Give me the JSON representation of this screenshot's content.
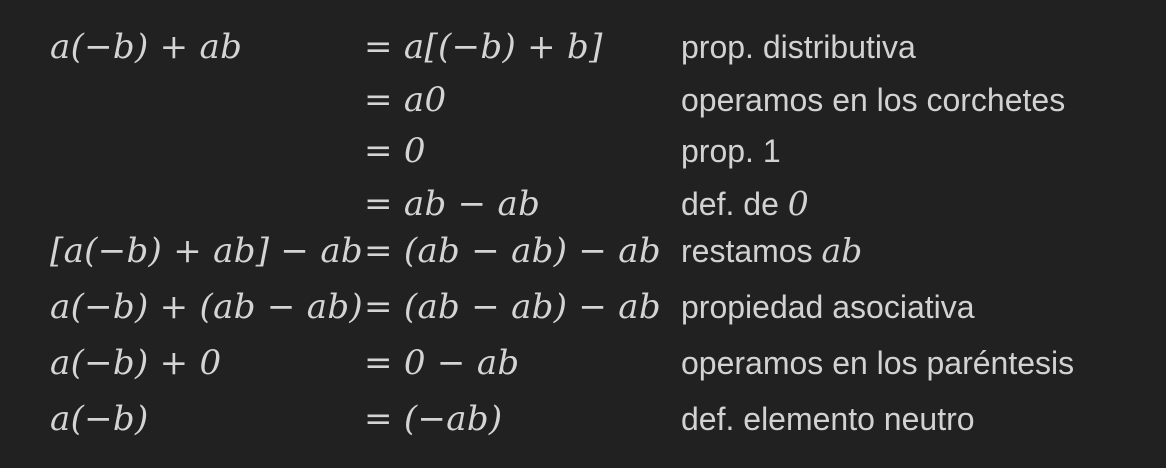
{
  "derivation": {
    "rows": [
      {
        "lhs": "a(−b) + ab",
        "rhs": "= a[(−b) + b]",
        "note": "prop. distributiva",
        "note_math": ""
      },
      {
        "lhs": "",
        "rhs": "= a0",
        "note": "operamos en los corchetes",
        "note_math": ""
      },
      {
        "lhs": "",
        "rhs": "= 0",
        "note": "prop. 1",
        "note_math": ""
      },
      {
        "lhs": "",
        "rhs": "= ab − ab",
        "note": "def. de",
        "note_math": "0"
      },
      {
        "lhs": "[a(−b) + ab] − ab",
        "rhs": "= (ab − ab) − ab",
        "note": "restamos",
        "note_math": "ab"
      },
      {
        "lhs": "a(−b) + (ab − ab)",
        "rhs": "= (ab − ab) − ab",
        "note": "propiedad asociativa",
        "note_math": ""
      },
      {
        "lhs": "a(−b) + 0",
        "rhs": "= 0 − ab",
        "note": "operamos en los paréntesis",
        "note_math": ""
      },
      {
        "lhs": "a(−b)",
        "rhs": "= (−ab)",
        "note": "def. elemento neutro",
        "note_math": ""
      }
    ]
  }
}
